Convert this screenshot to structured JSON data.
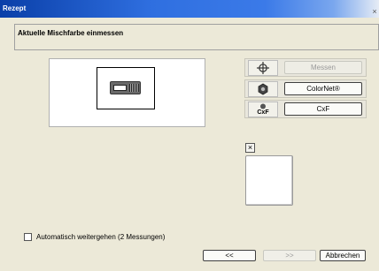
{
  "window": {
    "title": "Rezept",
    "close_glyph": "×"
  },
  "header": {
    "text": "Aktuelle Mischfarbe einmessen"
  },
  "buttons": {
    "messen": {
      "label": "Messen",
      "icon": "crosshair-icon",
      "enabled": false
    },
    "colornet": {
      "label": "ColorNet®",
      "icon": "colornet-icon",
      "enabled": true
    },
    "cxf": {
      "label": "CxF",
      "icon": "cxf-icon",
      "icon_text": "CxF",
      "enabled": true
    }
  },
  "swatch": {
    "close_glyph": "×",
    "color": "#ffffff"
  },
  "options": {
    "auto_continue_label": "Automatisch weitergehen (2 Messungen)",
    "auto_continue_checked": false
  },
  "nav": {
    "back_label": "<<",
    "next_label": ">>",
    "cancel_label": "Abbrechen"
  }
}
